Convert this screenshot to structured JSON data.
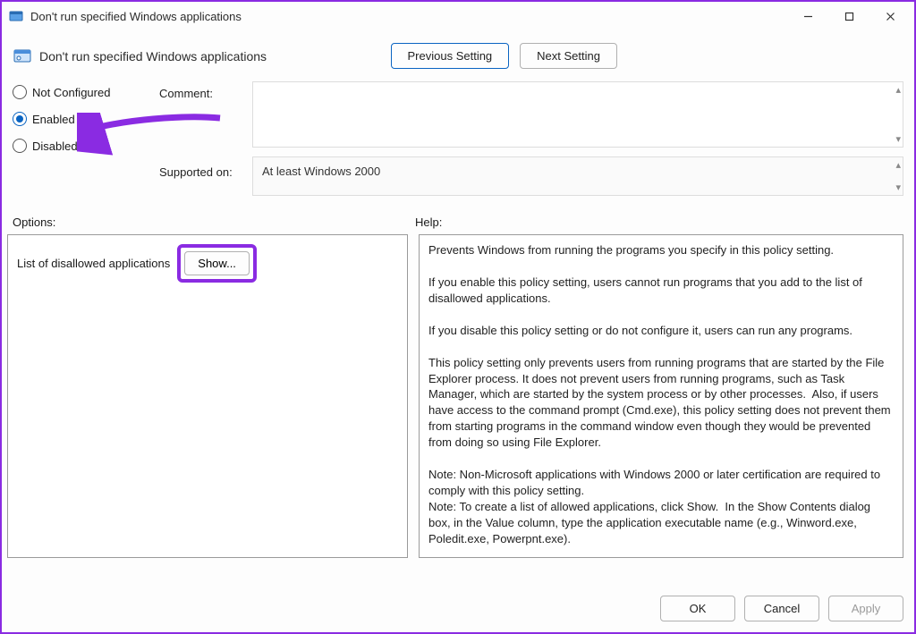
{
  "window": {
    "title": "Don't run specified Windows applications"
  },
  "header": {
    "title": "Don't run specified Windows applications",
    "prev": "Previous Setting",
    "next": "Next Setting"
  },
  "state": {
    "not_configured": "Not Configured",
    "enabled": "Enabled",
    "disabled": "Disabled",
    "selected": "Enabled"
  },
  "fields": {
    "comment_label": "Comment:",
    "supported_label": "Supported on:",
    "supported_value": "At least Windows 2000"
  },
  "panels": {
    "options_label": "Options:",
    "help_label": "Help:"
  },
  "options": {
    "list_label": "List of disallowed applications",
    "show_button": "Show..."
  },
  "help": {
    "text": "Prevents Windows from running the programs you specify in this policy setting.\n\nIf you enable this policy setting, users cannot run programs that you add to the list of disallowed applications.\n\nIf you disable this policy setting or do not configure it, users can run any programs.\n\nThis policy setting only prevents users from running programs that are started by the File Explorer process. It does not prevent users from running programs, such as Task Manager, which are started by the system process or by other processes.  Also, if users have access to the command prompt (Cmd.exe), this policy setting does not prevent them from starting programs in the command window even though they would be prevented from doing so using File Explorer.\n\nNote: Non-Microsoft applications with Windows 2000 or later certification are required to comply with this policy setting.\nNote: To create a list of allowed applications, click Show.  In the Show Contents dialog box, in the Value column, type the application executable name (e.g., Winword.exe, Poledit.exe, Powerpnt.exe)."
  },
  "footer": {
    "ok": "OK",
    "cancel": "Cancel",
    "apply": "Apply"
  }
}
